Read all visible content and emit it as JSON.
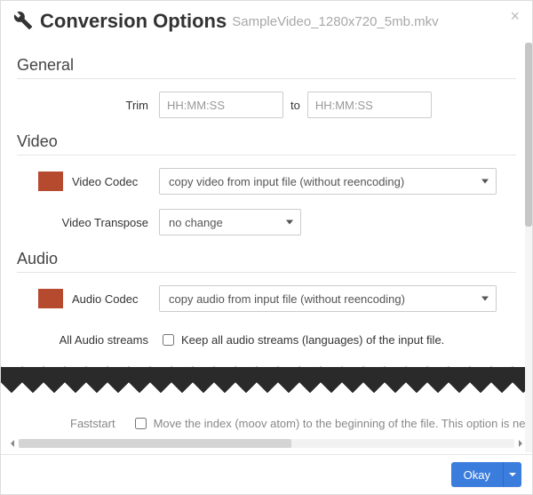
{
  "header": {
    "title": "Conversion Options",
    "filename": "SampleVideo_1280x720_5mb.mkv"
  },
  "sections": {
    "general": {
      "heading": "General",
      "trim": {
        "label": "Trim",
        "placeholder_from": "HH:MM:SS",
        "placeholder_to": "HH:MM:SS",
        "to_label": "to",
        "value_from": "",
        "value_to": ""
      }
    },
    "video": {
      "heading": "Video",
      "codec": {
        "label": "Video Codec",
        "selected": "copy video from input file (without reencoding)"
      },
      "transpose": {
        "label": "Video Transpose",
        "selected": "no change"
      }
    },
    "audio": {
      "heading": "Audio",
      "codec": {
        "label": "Audio Codec",
        "selected": "copy audio from input file (without reencoding)"
      },
      "all_streams": {
        "label": "All Audio streams",
        "checkbox_label": "Keep all audio streams (languages) of the input file.",
        "checked": false
      }
    },
    "faststart": {
      "label": "Faststart",
      "checkbox_label": "Move the index (moov atom) to the beginning of the file. This option is need",
      "checked": false
    }
  },
  "footer": {
    "okay": "Okay"
  },
  "colors": {
    "swatch": "#b64a2f",
    "primary": "#3b7ddd"
  }
}
